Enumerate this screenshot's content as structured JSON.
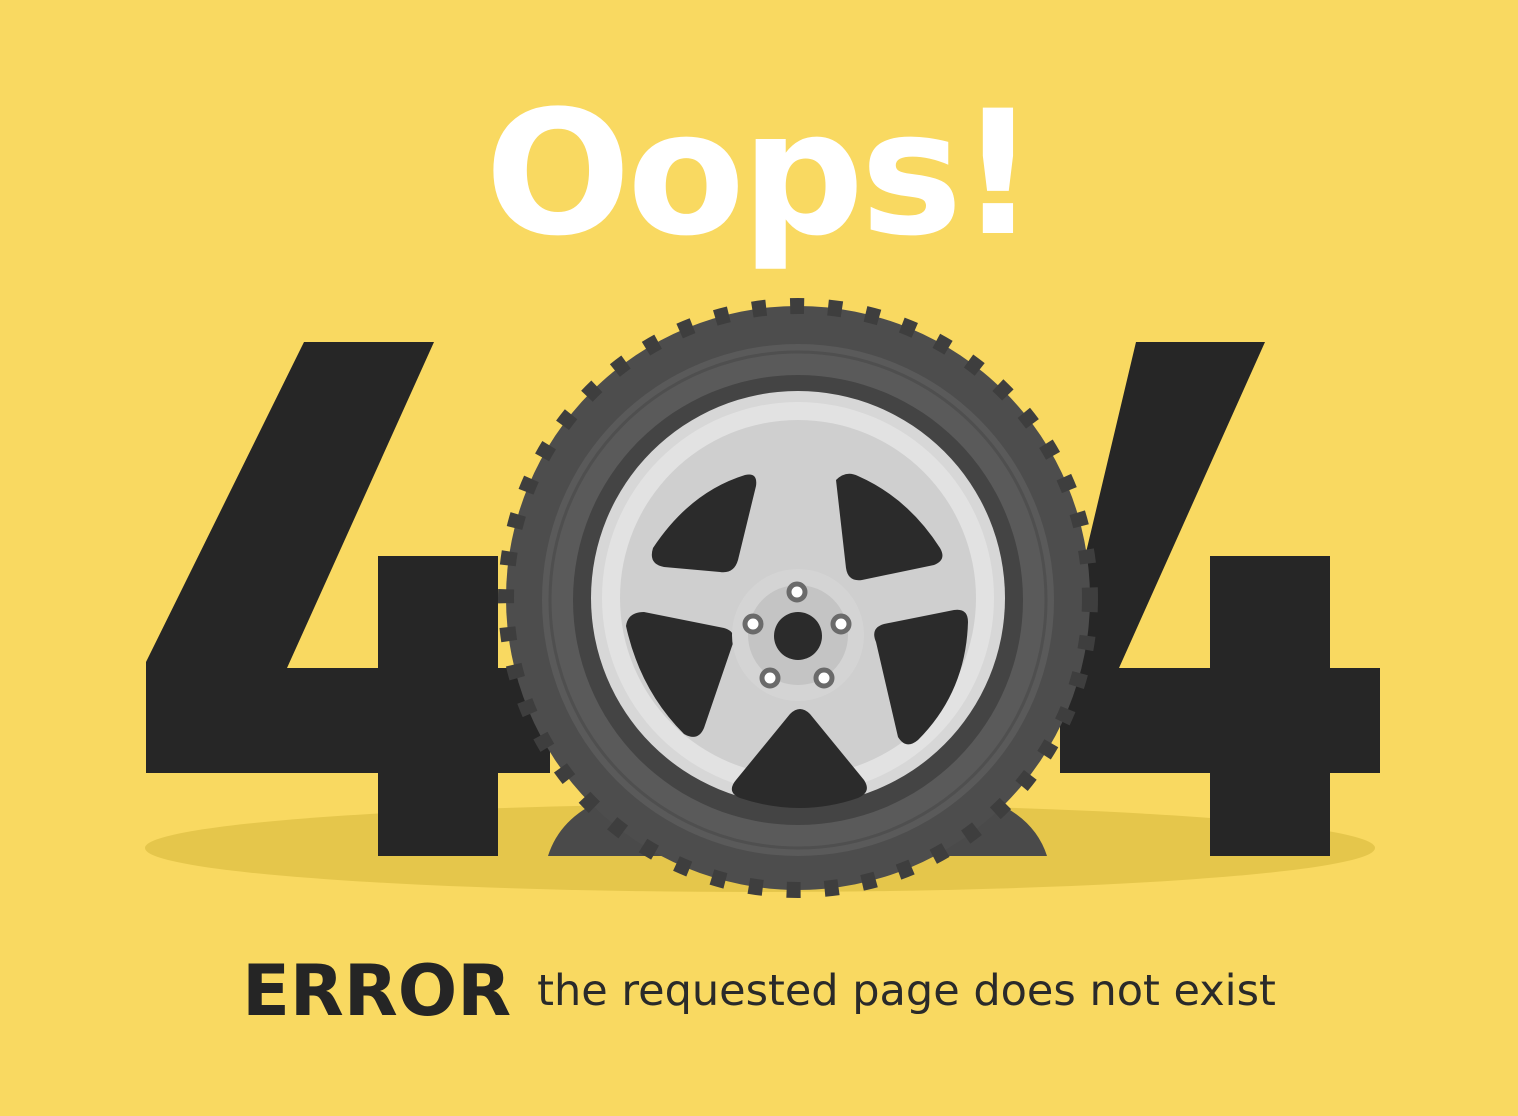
{
  "headline": "Oops!",
  "code": {
    "first_digit": "4",
    "last_digit": "4",
    "zero_replacement": "flat-tire-icon"
  },
  "error": {
    "label": "ERROR",
    "message": "the requested page does not exist"
  },
  "colors": {
    "background": "#f9d961",
    "shadow": "#e5c64b",
    "digits": "#262626",
    "headline": "#ffffff",
    "tire": "#4f4f4f",
    "rim": "#dcdcdc"
  }
}
